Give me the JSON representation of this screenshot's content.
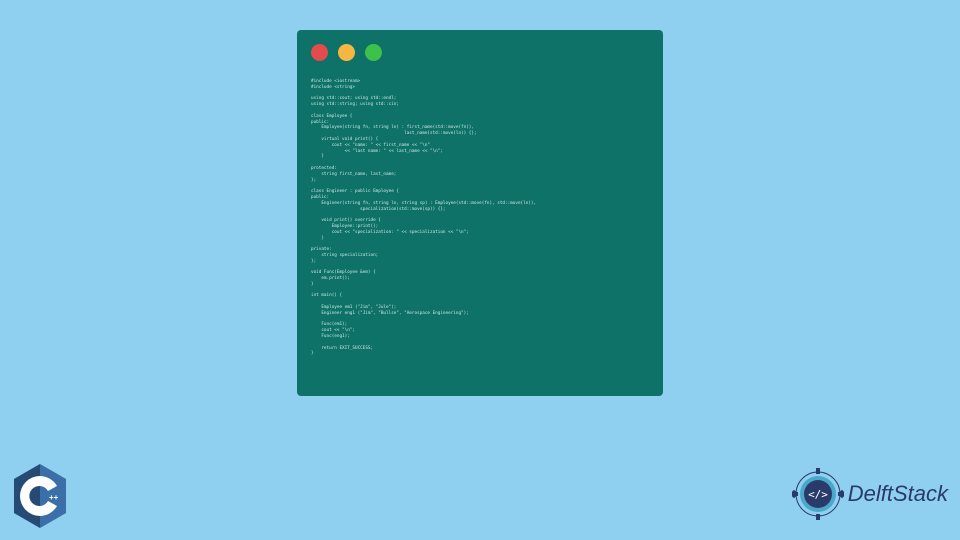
{
  "code_window": {
    "lines": [
      "#include <iostream>",
      "#include <string>",
      "",
      "using std::cout; using std::endl;",
      "using std::string; using std::cin;",
      "",
      "class Employee {",
      "public:",
      "    Employee(string fn, string ln) : first_name(std::move(fn)),",
      "                                    last_name(std::move(ln)) {};",
      "    virtual void print() {",
      "        cout << \"name: \" << first_name << \"\\n\"",
      "             << \"last name: \" << last_name << \"\\n\";",
      "    }",
      "",
      "protected:",
      "    string first_name, last_name;",
      "};",
      "",
      "class Engineer : public Employee {",
      "public:",
      "    Engineer(string fn, string ln, string sp) : Employee(std::move(fn), std::move(ln)),",
      "                   specialization(std::move(sp)) {};",
      "",
      "    void print() override {",
      "        Employee::print();",
      "        cout << \"specialization: \" << specialization << \"\\n\";",
      "    }",
      "",
      "private:",
      "    string specialization;",
      "};",
      "",
      "void Func(Employee &em) {",
      "    em.print();",
      "}",
      "",
      "int main() {",
      "",
      "    Employee em1 (\"Jim\", \"Jule\");",
      "    Engineer eng1 (\"Jim\", \"Bullse\", \"Aerospace Engineering\");",
      "",
      "    Func(em1);",
      "    cout << \"\\n\";",
      "    Func(eng1);",
      "",
      "    return EXIT_SUCCESS;",
      "}"
    ]
  },
  "branding": {
    "delftstack_text": "DelftStack"
  }
}
